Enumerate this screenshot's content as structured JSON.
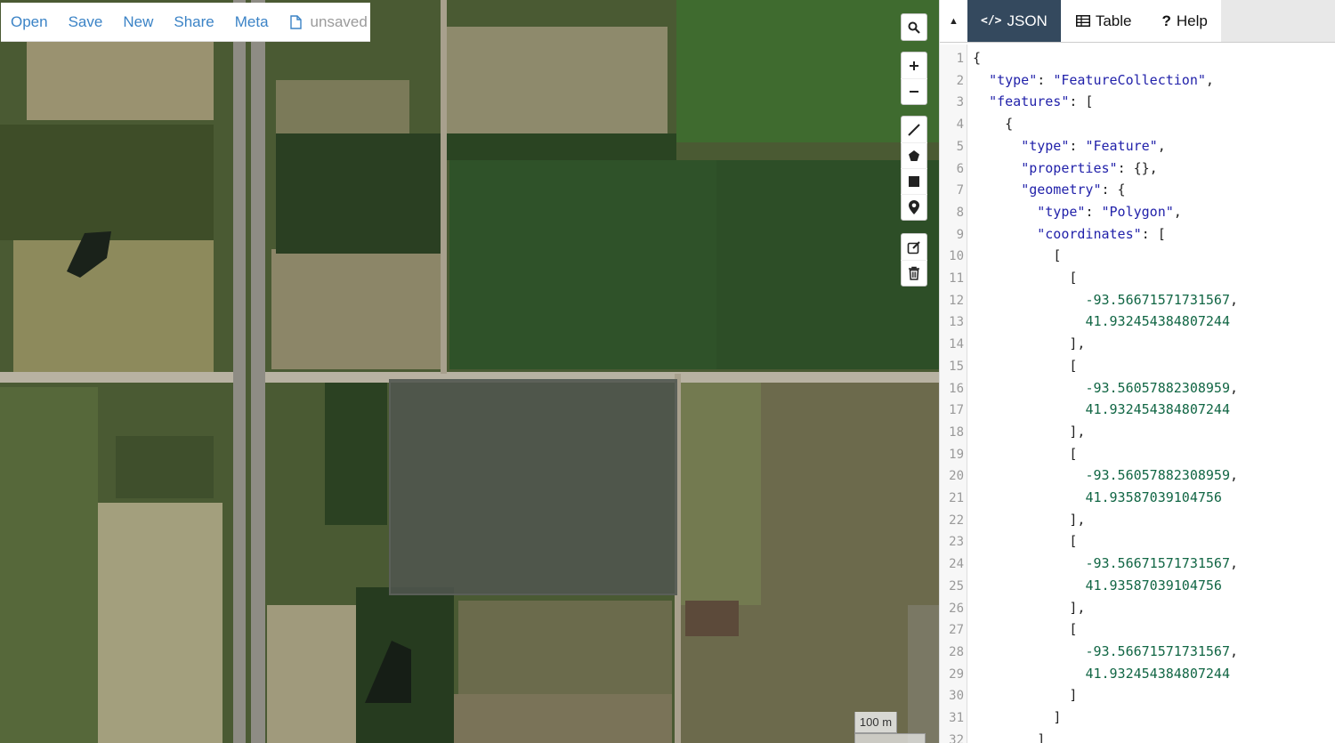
{
  "menubar": {
    "open": "Open",
    "save": "Save",
    "new": "New",
    "share": "Share",
    "meta": "Meta",
    "status": "unsaved"
  },
  "map": {
    "scale_label": "100 m",
    "tools": [
      "search-icon",
      "zoom-in-icon",
      "zoom-out-icon",
      "draw-line-icon",
      "draw-polygon-icon",
      "draw-rectangle-icon",
      "draw-marker-icon",
      "edit-layers-icon",
      "delete-layers-icon"
    ]
  },
  "tabs": {
    "json": "JSON",
    "table": "Table",
    "help": "Help"
  },
  "editor": {
    "lines": [
      {
        "n": "1",
        "indent": "",
        "parts": [
          [
            "p",
            "{"
          ]
        ]
      },
      {
        "n": "2",
        "indent": "  ",
        "parts": [
          [
            "k",
            "\"type\""
          ],
          [
            "p",
            ": "
          ],
          [
            "s",
            "\"FeatureCollection\""
          ],
          [
            "p",
            ","
          ]
        ]
      },
      {
        "n": "3",
        "indent": "  ",
        "parts": [
          [
            "k",
            "\"features\""
          ],
          [
            "p",
            ": ["
          ]
        ]
      },
      {
        "n": "4",
        "indent": "    ",
        "parts": [
          [
            "p",
            "{"
          ]
        ]
      },
      {
        "n": "5",
        "indent": "      ",
        "parts": [
          [
            "k",
            "\"type\""
          ],
          [
            "p",
            ": "
          ],
          [
            "s",
            "\"Feature\""
          ],
          [
            "p",
            ","
          ]
        ]
      },
      {
        "n": "6",
        "indent": "      ",
        "parts": [
          [
            "k",
            "\"properties\""
          ],
          [
            "p",
            ": {},"
          ]
        ]
      },
      {
        "n": "7",
        "indent": "      ",
        "parts": [
          [
            "k",
            "\"geometry\""
          ],
          [
            "p",
            ": {"
          ]
        ]
      },
      {
        "n": "8",
        "indent": "        ",
        "parts": [
          [
            "k",
            "\"type\""
          ],
          [
            "p",
            ": "
          ],
          [
            "s",
            "\"Polygon\""
          ],
          [
            "p",
            ","
          ]
        ]
      },
      {
        "n": "9",
        "indent": "        ",
        "parts": [
          [
            "k",
            "\"coordinates\""
          ],
          [
            "p",
            ": ["
          ]
        ]
      },
      {
        "n": "10",
        "indent": "          ",
        "parts": [
          [
            "p",
            "["
          ]
        ]
      },
      {
        "n": "11",
        "indent": "            ",
        "parts": [
          [
            "p",
            "["
          ]
        ]
      },
      {
        "n": "12",
        "indent": "              ",
        "parts": [
          [
            "n",
            "-93.56671571731567"
          ],
          [
            "p",
            ","
          ]
        ]
      },
      {
        "n": "13",
        "indent": "              ",
        "parts": [
          [
            "n",
            "41.932454384807244"
          ]
        ]
      },
      {
        "n": "14",
        "indent": "            ",
        "parts": [
          [
            "p",
            "],"
          ]
        ]
      },
      {
        "n": "15",
        "indent": "            ",
        "parts": [
          [
            "p",
            "["
          ]
        ]
      },
      {
        "n": "16",
        "indent": "              ",
        "parts": [
          [
            "n",
            "-93.56057882308959"
          ],
          [
            "p",
            ","
          ]
        ]
      },
      {
        "n": "17",
        "indent": "              ",
        "parts": [
          [
            "n",
            "41.932454384807244"
          ]
        ]
      },
      {
        "n": "18",
        "indent": "            ",
        "parts": [
          [
            "p",
            "],"
          ]
        ]
      },
      {
        "n": "19",
        "indent": "            ",
        "parts": [
          [
            "p",
            "["
          ]
        ]
      },
      {
        "n": "20",
        "indent": "              ",
        "parts": [
          [
            "n",
            "-93.56057882308959"
          ],
          [
            "p",
            ","
          ]
        ]
      },
      {
        "n": "21",
        "indent": "              ",
        "parts": [
          [
            "n",
            "41.93587039104756"
          ]
        ]
      },
      {
        "n": "22",
        "indent": "            ",
        "parts": [
          [
            "p",
            "],"
          ]
        ]
      },
      {
        "n": "23",
        "indent": "            ",
        "parts": [
          [
            "p",
            "["
          ]
        ]
      },
      {
        "n": "24",
        "indent": "              ",
        "parts": [
          [
            "n",
            "-93.56671571731567"
          ],
          [
            "p",
            ","
          ]
        ]
      },
      {
        "n": "25",
        "indent": "              ",
        "parts": [
          [
            "n",
            "41.93587039104756"
          ]
        ]
      },
      {
        "n": "26",
        "indent": "            ",
        "parts": [
          [
            "p",
            "],"
          ]
        ]
      },
      {
        "n": "27",
        "indent": "            ",
        "parts": [
          [
            "p",
            "["
          ]
        ]
      },
      {
        "n": "28",
        "indent": "              ",
        "parts": [
          [
            "n",
            "-93.56671571731567"
          ],
          [
            "p",
            ","
          ]
        ]
      },
      {
        "n": "29",
        "indent": "              ",
        "parts": [
          [
            "n",
            "41.932454384807244"
          ]
        ]
      },
      {
        "n": "30",
        "indent": "            ",
        "parts": [
          [
            "p",
            "]"
          ]
        ]
      },
      {
        "n": "31",
        "indent": "          ",
        "parts": [
          [
            "p",
            "]"
          ]
        ]
      },
      {
        "n": "32",
        "indent": "        ",
        "parts": [
          [
            "p",
            "]"
          ]
        ]
      }
    ]
  },
  "colors": {
    "accent": "#3b83c6",
    "tab_active": "#34495e",
    "json_key": "#2222aa",
    "json_number": "#116644"
  }
}
